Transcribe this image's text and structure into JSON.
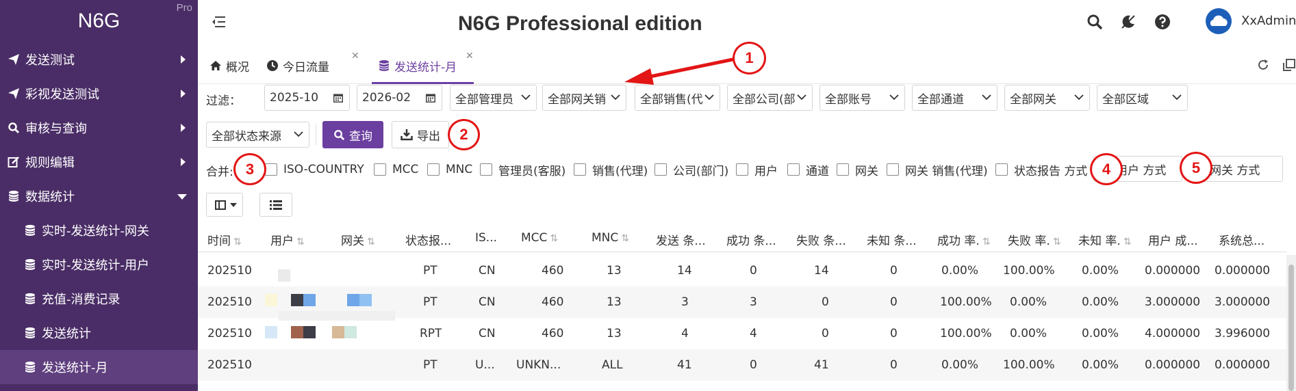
{
  "app": {
    "name": "N6G",
    "edition_badge": "Pro",
    "title": "N6G Professional edition",
    "user": "XxAdmin"
  },
  "colors": {
    "sidebar": "#4a2d66",
    "accent": "#6b3fa0",
    "annotation": "#e31515"
  },
  "sidebar": {
    "items": [
      {
        "label": "发送测试",
        "icon": "paper-plane-icon"
      },
      {
        "label": "彩视发送测试",
        "icon": "paper-plane-icon"
      },
      {
        "label": "审核与查询",
        "icon": "search-icon"
      },
      {
        "label": "规则编辑",
        "icon": "edit-icon"
      },
      {
        "label": "数据统计",
        "icon": "database-icon"
      },
      {
        "label": "实时-发送统计-网关",
        "icon": "database-icon"
      },
      {
        "label": "实时-发送统计-用户",
        "icon": "database-icon"
      },
      {
        "label": "充值-消费记录",
        "icon": "database-icon"
      },
      {
        "label": "发送统计",
        "icon": "database-icon"
      },
      {
        "label": "发送统计-月",
        "icon": "database-icon"
      }
    ]
  },
  "tabs": [
    {
      "label": "概况",
      "icon": "home-icon"
    },
    {
      "label": "今日流量",
      "icon": "clock-icon"
    },
    {
      "label": "发送统计-月",
      "icon": "database-icon"
    }
  ],
  "filters": {
    "label": "过滤：",
    "date_from": "2025-10",
    "date_to": "2026-02",
    "selects": [
      "全部管理员",
      "全部网关销",
      "全部销售(代",
      "全部公司(部",
      "全部账号",
      "全部通道",
      "全部网关",
      "全部区域",
      "全部状态来源"
    ],
    "query_label": "查询",
    "export_label": "导出"
  },
  "merge": {
    "label": "合并:",
    "options": [
      "ISO-COUNTRY",
      "MCC",
      "MNC",
      "管理员(客服)",
      "销售(代理)",
      "公司(部门)",
      "用户",
      "通道",
      "网关",
      "网关 销售(代理)",
      "状态报告 方式"
    ],
    "user_mode": "用户 方式",
    "gateway_mode": "网关 方式"
  },
  "annotations": [
    "1",
    "2",
    "3",
    "4",
    "5"
  ],
  "table": {
    "headers": [
      "时间",
      "用户",
      "网关",
      "状态报...",
      "IS...",
      "MCC",
      "MNC",
      "发送 条...",
      "成功 条...",
      "失败 条...",
      "未知 条...",
      "成功 率.",
      "失败 率.",
      "未知 率.",
      "用户 成...",
      "系统总..."
    ],
    "rows": [
      [
        "202510",
        "",
        "",
        "PT",
        "CN",
        "460",
        "13",
        "14",
        "0",
        "14",
        "0",
        "0.00%",
        "100.00%",
        "0.00%",
        "0.000000",
        "0.000000"
      ],
      [
        "202510",
        "",
        "",
        "PT",
        "CN",
        "460",
        "13",
        "3",
        "3",
        "0",
        "0",
        "100.00%",
        "0.00%",
        "0.00%",
        "3.000000",
        "3.000000"
      ],
      [
        "202510",
        "",
        "",
        "RPT",
        "CN",
        "460",
        "13",
        "4",
        "4",
        "0",
        "0",
        "100.00%",
        "0.00%",
        "0.00%",
        "4.000000",
        "3.996000"
      ],
      [
        "202510",
        "",
        "",
        "PT",
        "U...",
        "UNKN...",
        "ALL",
        "41",
        "0",
        "41",
        "0",
        "0.00%",
        "100.00%",
        "0.00%",
        "0.000000",
        "0.000000"
      ]
    ]
  }
}
